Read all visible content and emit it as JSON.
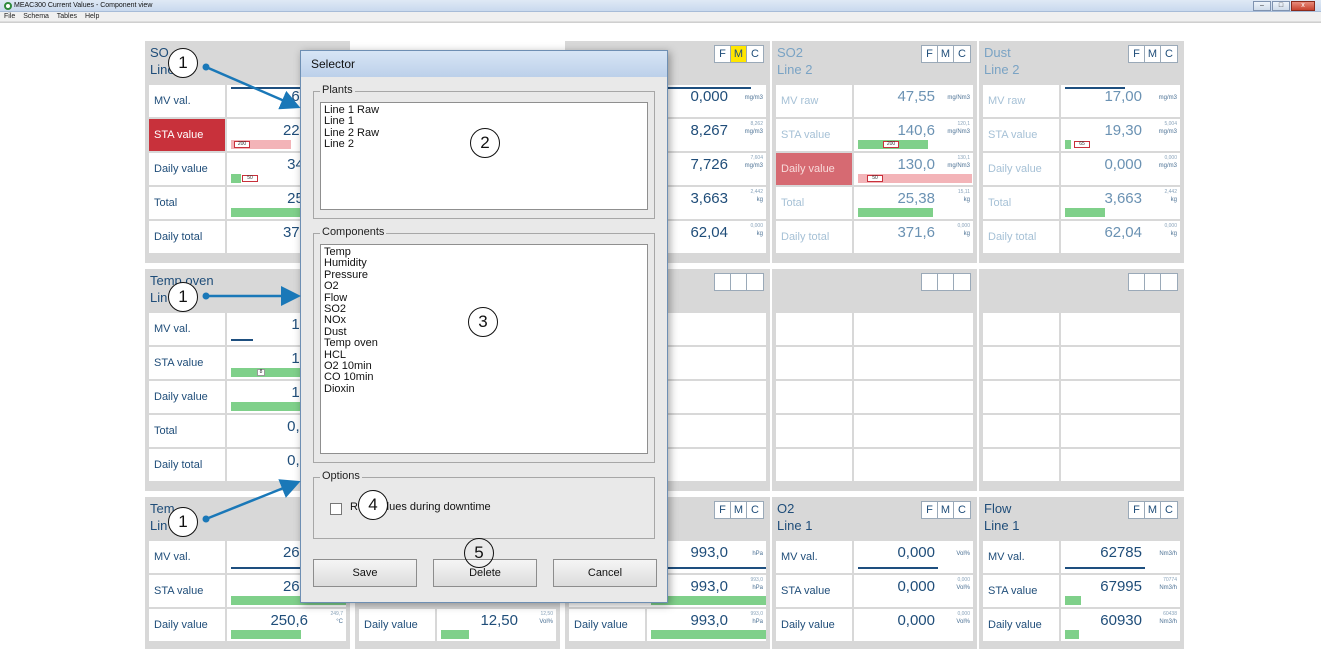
{
  "window": {
    "title": "MEAC300 Current Values - Component view",
    "buttons": [
      "–",
      "□",
      "x"
    ]
  },
  "menu": [
    "File",
    "Schema",
    "Tables",
    "Help"
  ],
  "fmc_labels": [
    "F",
    "M",
    "C"
  ],
  "panels": {
    "so2_line1": {
      "title": "SO\nLine",
      "rows": [
        {
          "label": "MV val.",
          "value": "62"
        },
        {
          "label": "STA value",
          "value": "229",
          "mini": "200"
        },
        {
          "label": "Daily value",
          "value": "34,",
          "mini": "50"
        },
        {
          "label": "Total",
          "value": "25,"
        },
        {
          "label": "Daily total",
          "value": "371"
        }
      ]
    },
    "col3_row1": {
      "rows": [
        {
          "value": "0,000",
          "unit": "mg/m3"
        },
        {
          "value": "8,267",
          "limit": "8,262",
          "unit": "mg/m3"
        },
        {
          "value": "7,726",
          "limit": "7,604",
          "unit": "mg/m3"
        },
        {
          "value": "3,663",
          "limit": "2,442",
          "unit": "kg"
        },
        {
          "value": "62,04",
          "limit": "0,000",
          "unit": "kg"
        }
      ]
    },
    "so2_line2": {
      "title": "SO2\nLine 2",
      "rows": [
        {
          "label": "MV raw",
          "value": "47,55",
          "unit": "mg/Nm3"
        },
        {
          "label": "STA value",
          "value": "140,6",
          "limit": "120,1",
          "unit": "mg/Nm3",
          "mini": "200"
        },
        {
          "label": "Daily value",
          "value": "130,0",
          "limit": "130,1",
          "unit": "mg/Nm3",
          "mini": "50"
        },
        {
          "label": "Total",
          "value": "25,38",
          "limit": "15,11",
          "unit": "kg"
        },
        {
          "label": "Daily total",
          "value": "371,6",
          "limit": "0,000",
          "unit": "kg"
        }
      ]
    },
    "dust_line2": {
      "title": "Dust\nLine 2",
      "rows": [
        {
          "label": "MV raw",
          "value": "17,00",
          "unit": "mg/m3"
        },
        {
          "label": "STA value",
          "value": "19,30",
          "limit": "5,004",
          "unit": "mg/m3",
          "mini": "65"
        },
        {
          "label": "Daily value",
          "value": "0,000",
          "limit": "0,000",
          "unit": "mg/m3"
        },
        {
          "label": "Total",
          "value": "3,663",
          "limit": "2,442",
          "unit": "kg"
        },
        {
          "label": "Daily total",
          "value": "62,04",
          "limit": "0,000",
          "unit": "kg"
        }
      ]
    },
    "temp_oven": {
      "title": "Temp oven\nLin",
      "rows": [
        {
          "label": "MV val.",
          "value": "12"
        },
        {
          "label": "STA value",
          "value": "12",
          "mini": "8"
        },
        {
          "label": "Daily value",
          "value": "12"
        },
        {
          "label": "Total",
          "value": "0,0"
        },
        {
          "label": "Daily total",
          "value": "0,0"
        }
      ]
    },
    "temp_line1": {
      "title": "Tem\nLin",
      "rows": [
        {
          "label": "MV val.",
          "value": "262"
        },
        {
          "label": "STA value",
          "value": "263"
        },
        {
          "label": "Daily value",
          "value": "250,6",
          "limit": "249,7",
          "unit": "°C"
        }
      ]
    },
    "col2_row3": {
      "rows": [
        {
          "label": "Daily value",
          "value": "12,50",
          "limit": "12,50",
          "unit": "Vol%"
        }
      ]
    },
    "col3_row3": {
      "rows": [
        {
          "value": "993,0",
          "unit": "hPa"
        },
        {
          "value": "993,0",
          "limit": "993,0",
          "unit": "hPa"
        },
        {
          "label": "Daily value",
          "value": "993,0",
          "limit": "993,0",
          "unit": "hPa"
        }
      ]
    },
    "o2_line1": {
      "title": "O2\nLine 1",
      "rows": [
        {
          "label": "MV val.",
          "value": "0,000",
          "unit": "Vol%"
        },
        {
          "label": "STA value",
          "value": "0,000",
          "limit": "0,000",
          "unit": "Vol%"
        },
        {
          "label": "Daily value",
          "value": "0,000",
          "limit": "0,000",
          "unit": "Vol%"
        }
      ]
    },
    "flow_line1": {
      "title": "Flow\nLine 1",
      "rows": [
        {
          "label": "MV val.",
          "value": "62785",
          "unit": "Nm3/h"
        },
        {
          "label": "STA value",
          "value": "67995",
          "limit": "70774",
          "unit": "Nm3/h"
        },
        {
          "label": "Daily value",
          "value": "60930",
          "limit": "60438",
          "unit": "Nm3/h"
        }
      ]
    }
  },
  "dialog": {
    "title": "Selector",
    "plants_label": "Plants",
    "plants": [
      "Line 1 Raw",
      "Line 1",
      "Line 2 Raw",
      "Line 2"
    ],
    "components_label": "Components",
    "components": [
      "Temp",
      "Humidity",
      "Pressure",
      "O2",
      "Flow",
      "SO2",
      "NOx",
      "Dust",
      "Temp oven",
      "HCL",
      "O2 10min",
      "CO 10min",
      "Dioxin"
    ],
    "options_label": "Options",
    "checkbox_label": "Raw values during downtime",
    "save": "Save",
    "delete": "Delete",
    "cancel": "Cancel"
  },
  "callouts": [
    "1",
    "2",
    "3",
    "4",
    "5"
  ],
  "colors": {
    "panel_bg": "#d8d8d8",
    "value_text": "#1f4d79",
    "alarm_red": "#c8313b",
    "bar_green": "#7fd08a",
    "bar_blue": "#1e4f7f",
    "fmc_active": "#ffe600",
    "callout_arrow": "#1a78b8"
  }
}
